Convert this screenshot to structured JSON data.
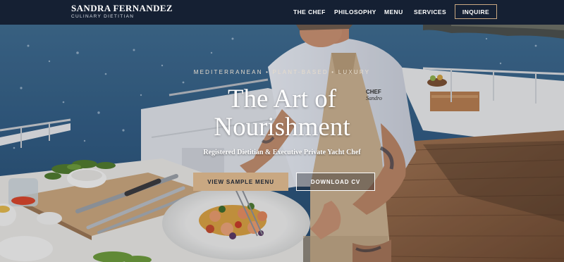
{
  "brand": {
    "name": "SANDRA FERNANDEZ",
    "subtitle": "CULINARY DIETITIAN"
  },
  "nav": {
    "links": [
      "THE CHEF",
      "PHILOSOPHY",
      "MENU",
      "SERVICES"
    ],
    "cta": "INQUIRE"
  },
  "hero": {
    "tagline": "MEDITERRANEAN • PLANT-BASED • LUXURY",
    "title_line1": "The Art of",
    "title_line2": "Nourishment",
    "subtitle": "Registered Dietitian & Executive Private Yacht Chef",
    "primary_button": "VIEW SAMPLE MENU",
    "secondary_button": "DOWNLOAD CV",
    "apron_text_1": "CHEF",
    "apron_text_2": "Sandro"
  },
  "colors": {
    "nav_bg": "#152033",
    "accent": "#c9a882",
    "text_light": "#ffffff"
  }
}
